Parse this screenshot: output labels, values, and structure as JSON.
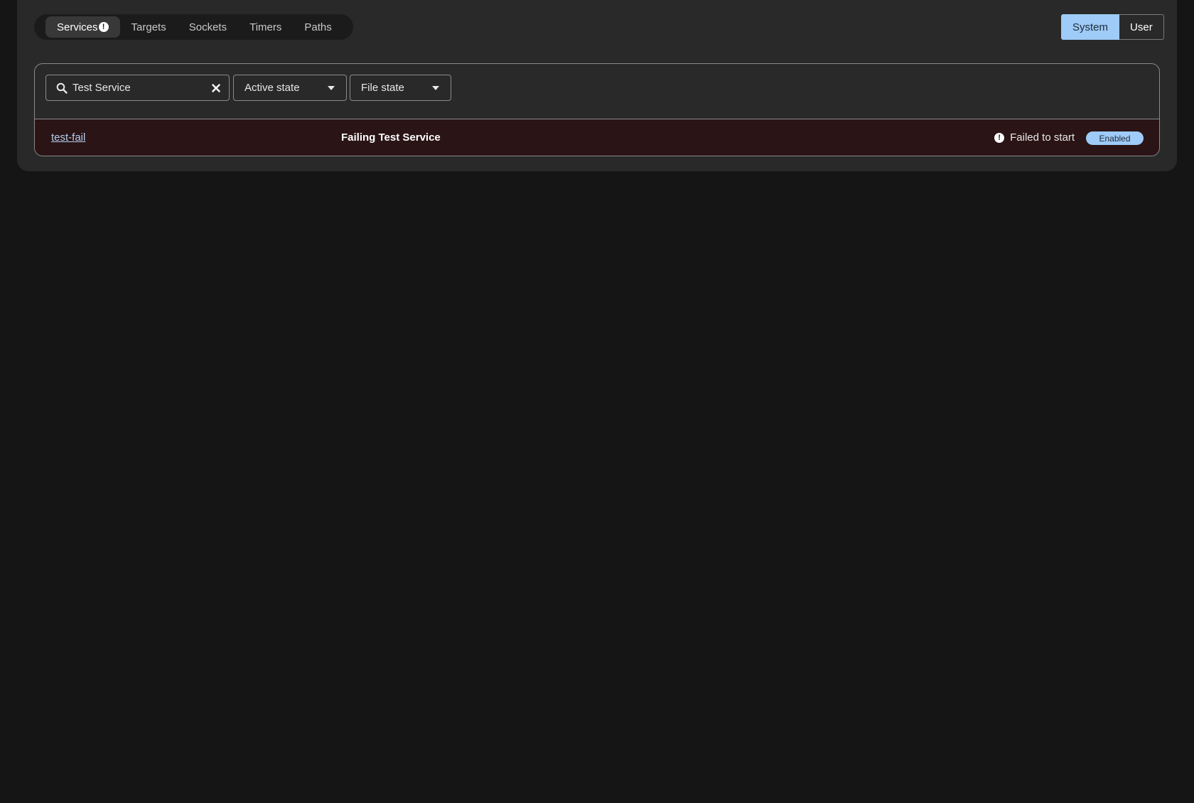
{
  "tabs": [
    {
      "label": "Services",
      "active": true,
      "alert": true
    },
    {
      "label": "Targets"
    },
    {
      "label": "Sockets"
    },
    {
      "label": "Timers"
    },
    {
      "label": "Paths"
    }
  ],
  "scope_toggle": {
    "system_label": "System",
    "user_label": "User",
    "selected": "System"
  },
  "toolbar": {
    "search_value": "Test Service",
    "active_state_label": "Active state",
    "file_state_label": "File state"
  },
  "rows": [
    {
      "unit": "test-fail",
      "description": "Failing Test Service",
      "status": "Failed to start",
      "badge": "Enabled"
    }
  ],
  "colors": {
    "background": "#151515",
    "card": "#292929",
    "accent": "#9ecbf7",
    "failed_row": "#2a1416"
  }
}
